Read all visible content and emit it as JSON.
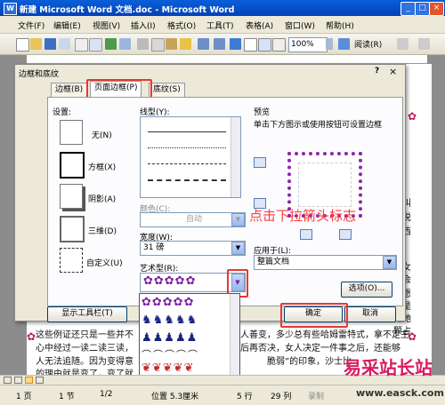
{
  "window": {
    "title": "新建 Microsoft Word 文档.doc - Microsoft Word"
  },
  "menubar": {
    "items": [
      "文件(F)",
      "编辑(E)",
      "视图(V)",
      "插入(I)",
      "格式(O)",
      "工具(T)",
      "表格(A)",
      "窗口(W)",
      "帮助(H)"
    ]
  },
  "toolbar": {
    "zoom": "100%",
    "read_label": "阅读(R)"
  },
  "document": {
    "lines": [
      "这些例证还只是一些并不",
      "心中经过一读二读三读，",
      "人无法追随。因为变得意",
      "的理由就是变了，变了就"
    ],
    "right_fragments": [
      "才叫",
      "于说",
      "孩西",
      "个女",
      "如会",
      "人愿",
      "就是",
      "是她",
      "颗占"
    ],
    "line1_tail": "女人善变，多少总有些哈姆雷特式，拿不定主",
    "line2_tail": "之后再否决，女人决定一件事之后，还能够",
    "line3_tail": "脆弱”的印象，沙士比"
  },
  "dialog": {
    "title": "边框和底纹",
    "tabs": [
      "边框(B)",
      "页面边框(P)",
      "底纹(S)"
    ],
    "settings_label": "设置:",
    "settings": [
      "无(N)",
      "方框(X)",
      "阴影(A)",
      "三维(D)",
      "自定义(U)"
    ],
    "line_style_label": "线型(Y):",
    "color_label": "颜色(C):",
    "color_value": "自动",
    "width_label": "宽度(W):",
    "width_value": "31 磅",
    "art_label": "艺术型(R):",
    "preview_label": "预览",
    "preview_hint": "单击下方图示或使用按钮可设置边框",
    "apply_label": "应用于(L):",
    "apply_value": "整篇文档",
    "options_button": "选项(O)...",
    "toolbar_button": "显示工具栏(T)",
    "ok_button": "确定",
    "cancel_button": "取消",
    "help_icon": "?",
    "close_icon": "×"
  },
  "annotation": {
    "text": "点击下拉箭头标志"
  },
  "statusbar": {
    "page": "1 页",
    "section": "1 节",
    "pages": "1/2",
    "position": "位置 5.3厘米",
    "line": "5 行",
    "column": "29 列",
    "mode": "录制"
  },
  "watermark": {
    "text": "易采站长站",
    "url": "www.easck.com"
  },
  "colors": {
    "accent_red": "#e53935",
    "annotation_red": "#ff3b3b",
    "title_blue": "#0a5fd8"
  }
}
